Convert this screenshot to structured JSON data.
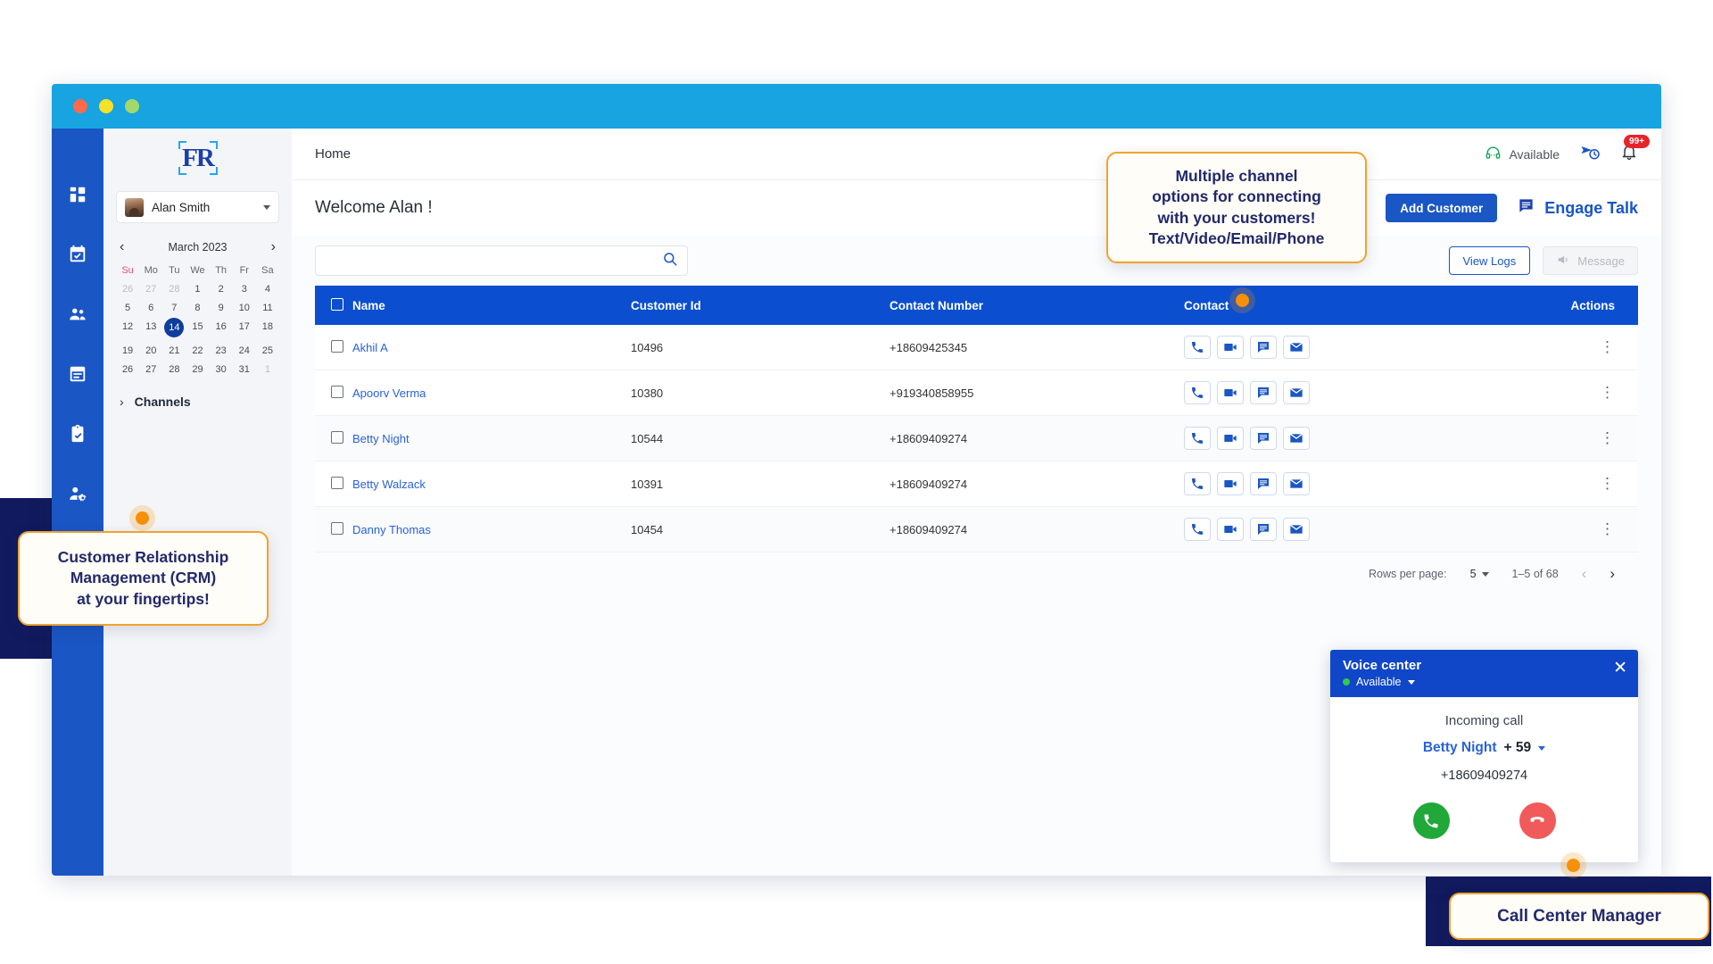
{
  "window": {
    "traffic_lights": [
      "close",
      "minimize",
      "maximize"
    ]
  },
  "sidebar_rail": {
    "items": [
      {
        "icon": "dashboard-grid-icon",
        "name": "dashboard"
      },
      {
        "icon": "calendar-check-icon",
        "name": "schedule"
      },
      {
        "icon": "people-icon",
        "name": "contacts"
      },
      {
        "icon": "calendar-icon",
        "name": "events"
      },
      {
        "icon": "clipboard-check-icon",
        "name": "tasks"
      },
      {
        "icon": "user-settings-icon",
        "name": "user-admin"
      },
      {
        "icon": "apps-icon",
        "name": "integrations"
      },
      {
        "icon": "bar-chart-icon",
        "name": "reports"
      }
    ]
  },
  "left_panel": {
    "logo_text": "FR",
    "user": {
      "name": "Alan Smith"
    },
    "calendar": {
      "month_label": "March 2023",
      "prev_label": "‹",
      "next_label": "›",
      "day_headers": [
        "Su",
        "Mo",
        "Tu",
        "We",
        "Th",
        "Fr",
        "Sa"
      ],
      "selected_day": "14",
      "weeks": [
        [
          {
            "d": "26",
            "muted": true
          },
          {
            "d": "27",
            "muted": true
          },
          {
            "d": "28",
            "muted": true
          },
          {
            "d": "1"
          },
          {
            "d": "2"
          },
          {
            "d": "3"
          },
          {
            "d": "4"
          }
        ],
        [
          {
            "d": "5"
          },
          {
            "d": "6"
          },
          {
            "d": "7"
          },
          {
            "d": "8"
          },
          {
            "d": "9"
          },
          {
            "d": "10"
          },
          {
            "d": "11"
          }
        ],
        [
          {
            "d": "12"
          },
          {
            "d": "13"
          },
          {
            "d": "14",
            "selected": true
          },
          {
            "d": "15"
          },
          {
            "d": "16"
          },
          {
            "d": "17"
          },
          {
            "d": "18"
          }
        ],
        [
          {
            "d": "19"
          },
          {
            "d": "20"
          },
          {
            "d": "21"
          },
          {
            "d": "22"
          },
          {
            "d": "23"
          },
          {
            "d": "24"
          },
          {
            "d": "25"
          }
        ],
        [
          {
            "d": "26"
          },
          {
            "d": "27"
          },
          {
            "d": "28"
          },
          {
            "d": "29"
          },
          {
            "d": "30"
          },
          {
            "d": "31"
          },
          {
            "d": "1",
            "muted": true
          }
        ]
      ]
    },
    "channels_label": "Channels",
    "channels_arrow": "›"
  },
  "topbar": {
    "breadcrumb": "Home",
    "availability_label": "Available",
    "availability_color": "#1aa35a",
    "send_later_icon": "send-clock-icon",
    "bell_icon": "bell-icon",
    "notification_badge": "99+",
    "badge_color": "#e8232a"
  },
  "welcome": {
    "greeting": "Welcome Alan !",
    "add_customer_label": "Add Customer",
    "engage_talk_label": "Engage Talk"
  },
  "search": {
    "value": "",
    "placeholder": "",
    "icon": "search-icon",
    "view_logs_label": "View Logs",
    "message_label": "Message"
  },
  "table": {
    "columns": [
      "Name",
      "Customer Id",
      "Contact Number",
      "Contact",
      "Actions"
    ],
    "contact_actions": [
      "phone-icon",
      "video-icon",
      "chat-icon",
      "email-icon"
    ],
    "rows": [
      {
        "name": "Akhil A",
        "customer_id": "10496",
        "contact_number": "+18609425345"
      },
      {
        "name": "Apoorv Verma",
        "customer_id": "10380",
        "contact_number": "+919340858955"
      },
      {
        "name": "Betty Night",
        "customer_id": "10544",
        "contact_number": "+18609409274"
      },
      {
        "name": "Betty Walzack",
        "customer_id": "10391",
        "contact_number": "+18609409274"
      },
      {
        "name": "Danny Thomas",
        "customer_id": "10454",
        "contact_number": "+18609409274"
      }
    ]
  },
  "pagination": {
    "rows_per_page_label": "Rows per page:",
    "rows_per_page_value": "5",
    "range_label": "1–5 of 68",
    "prev": "‹",
    "next": "›"
  },
  "voice_center": {
    "title": "Voice center",
    "status": "Available",
    "status_color": "#2ecc4a",
    "close_icon": "close-icon",
    "incoming_label": "Incoming call",
    "caller_name": "Betty Night",
    "caller_extra": "+ 59",
    "caller_number": "+18609409274",
    "accept_icon": "phone-icon",
    "decline_icon": "phone-hangup-icon"
  },
  "callouts": {
    "channels": "Multiple channel\noptions for connecting\nwith your customers!\nText/Video/Email/Phone",
    "crm": "Customer Relationship\nManagement (CRM)\nat your fingertips!",
    "call_center": "Call Center Manager"
  }
}
